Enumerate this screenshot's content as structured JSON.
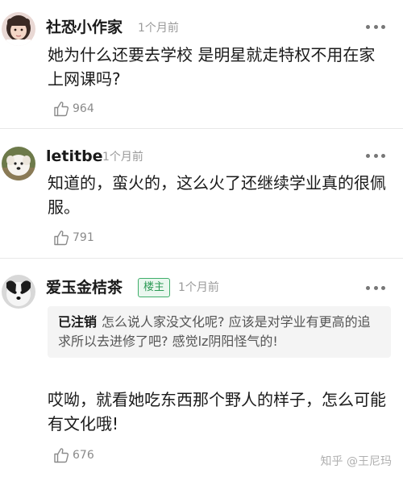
{
  "comments": [
    {
      "username": "社恐小作家",
      "time": "1个月前",
      "text": "她为什么还要去学校 是明星就走特权不用在家上网课吗?",
      "likes": "964",
      "avatar_icon": "girl-avatar"
    },
    {
      "username": "letitbe",
      "time": "1个月前",
      "text": "知道的，蛮火的，这么火了还继续学业真的很佩服。",
      "likes": "791",
      "avatar_icon": "dog-avatar"
    },
    {
      "username": "爱玉金桔茶",
      "badge": "楼主",
      "time": "1个月前",
      "quote_author": "已注销",
      "quote_text": "怎么说人家没文化呢? 应该是对学业有更高的追求所以去进修了吧? 感觉lz阴阳怪气的!",
      "text": "哎呦，就看她吃东西那个野人的样子，怎么可能有文化哦!",
      "likes": "676",
      "avatar_icon": "dog-avatar-bw"
    }
  ],
  "watermark": "知乎 @王尼玛",
  "colors": {
    "badge_green": "#2d9a56",
    "meta_gray": "#9a9a9a",
    "divider": "#e8e8e8"
  }
}
